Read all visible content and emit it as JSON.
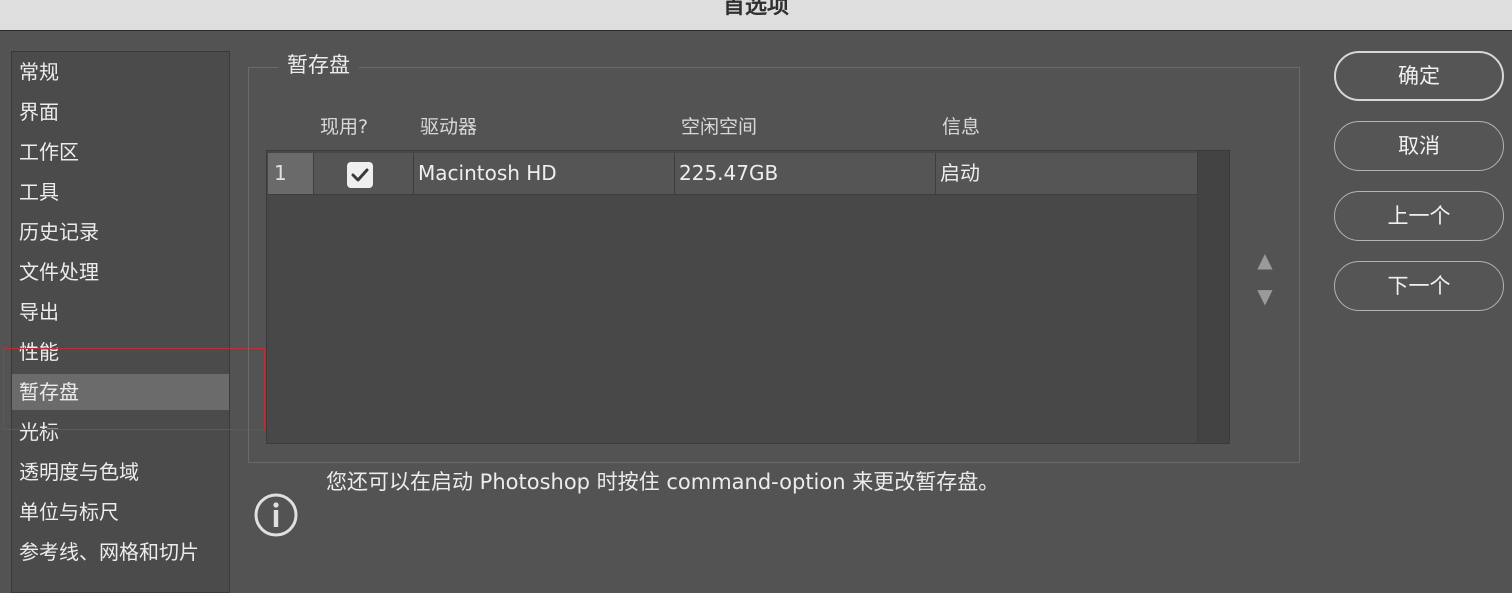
{
  "window": {
    "title": "首选项"
  },
  "sidebar": {
    "items": [
      {
        "label": "常规"
      },
      {
        "label": "界面"
      },
      {
        "label": "工作区"
      },
      {
        "label": "工具"
      },
      {
        "label": "历史记录"
      },
      {
        "label": "文件处理"
      },
      {
        "label": "导出"
      },
      {
        "label": "性能"
      },
      {
        "label": "暂存盘",
        "selected": true
      },
      {
        "label": "光标"
      },
      {
        "label": "透明度与色域"
      },
      {
        "label": "单位与标尺"
      },
      {
        "label": "参考线、网格和切片"
      }
    ]
  },
  "panel": {
    "legend": "暂存盘",
    "columns": [
      "现用?",
      "驱动器",
      "空闲空间",
      "信息"
    ],
    "rows": [
      {
        "index": "1",
        "active": true,
        "drive": "Macintosh HD",
        "free_space": "225.47GB",
        "info": "启动"
      }
    ],
    "info_text": "您还可以在启动 Photoshop 时按住 command-option 来更改暂存盘。"
  },
  "buttons": {
    "ok": "确定",
    "cancel": "取消",
    "prev": "上一个",
    "next": "下一个"
  },
  "icons": {
    "move_up": "triangle-up-icon",
    "move_down": "triangle-down-icon",
    "info": "info-circle-icon",
    "checkbox": "checkmark-icon"
  },
  "colors": {
    "background": "#535353",
    "selected_item": "#6b6b6b",
    "annotation_box": "#b8303a"
  }
}
